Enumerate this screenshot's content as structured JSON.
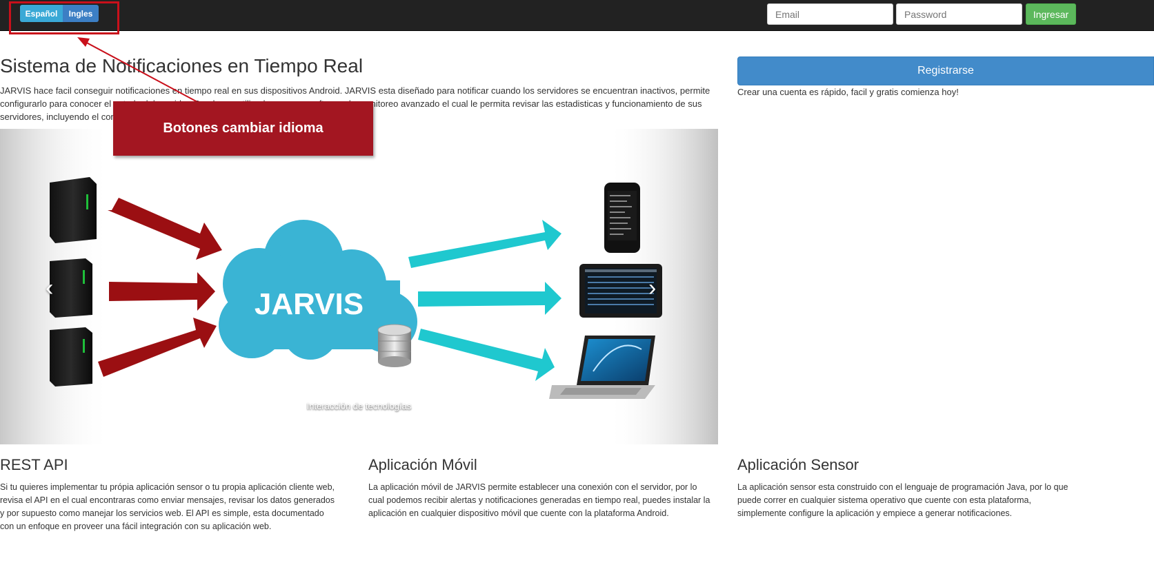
{
  "navbar": {
    "lang_es": "Español",
    "lang_en": "Ingles",
    "email_placeholder": "Email",
    "password_placeholder": "Password",
    "login_label": "Ingresar"
  },
  "hero": {
    "title": "Sistema de Notificaciones en Tiempo Real",
    "text": "JARVIS hace facil conseguir notificaciones en tiempo real en sus dispositivos Android. JARVIS esta diseñado para notificar cuando los servidores se encuentran inactivos, permite configurarlo para conocer el estado del servidor. Puede ser utilizado como un software de monitoreo avanzado el cual le permita revisar las estadisticas y funcionamiento de sus servidores, incluyendo el consumo de recursos de hardware y el estado de las aplicaciones."
  },
  "annotation": {
    "callout_label": "Botones cambiar idioma"
  },
  "carousel": {
    "center_label": "JARVIS",
    "caption": "Interacción de tecnologías",
    "prev_icon": "chevron-left-icon",
    "next_icon": "chevron-right-icon"
  },
  "register": {
    "button_label": "Registrarse",
    "note": "Crear una cuenta es rápido, facil y gratis comienza hoy!"
  },
  "features": [
    {
      "title": "REST API",
      "text": "Si tu quieres implementar tu própia aplicación sensor o tu propia aplicación cliente web, revisa el API en el cual encontraras como enviar mensajes, revisar los datos generados y por supuesto como manejar los servicios web. El API es simple, esta documentado con un enfoque en proveer una fácil integración con su aplicación web."
    },
    {
      "title": "Aplicación Móvil",
      "text": "La aplicación móvil de JARVIS permite establecer una conexión con el servidor, por lo cual podemos recibir alertas y notificaciones generadas en tiempo real, puedes instalar la aplicación en cualquier dispositivo móvil que cuente con la plataforma Android."
    },
    {
      "title": "Aplicación Sensor",
      "text": "La aplicación sensor esta construido con el lenguaje de programación Java, por lo que puede correr en cualquier sistema operativo que cuente con esta plataforma, simplemente configure la aplicación y empiece a generar notificaciones."
    }
  ],
  "colors": {
    "navbar_bg": "#222222",
    "brand_blue": "#428bca",
    "success_green": "#5cb85c",
    "annotation_red": "#a31621",
    "cloud_blue": "#3ab4d4",
    "arrow_red": "#9b0f12",
    "arrow_cyan": "#1fc8cf"
  }
}
